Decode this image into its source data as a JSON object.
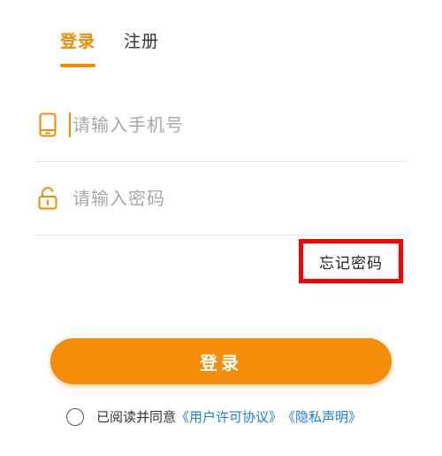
{
  "tabs": {
    "login": "登录",
    "register": "注册"
  },
  "phone": {
    "placeholder": "请输入手机号",
    "icon": "phone-icon"
  },
  "password": {
    "placeholder": "请输入密码",
    "icon": "lock-icon"
  },
  "forgot_password": "忘记密码",
  "login_button": "登录",
  "agreement": {
    "text": "已阅读并同意",
    "user_agreement": "《用户许可协议》",
    "privacy": "《隐私声明》"
  },
  "colors": {
    "accent": "#f08c00",
    "button": "#f58c0a",
    "link": "#1a7fd4",
    "highlight_box": "#ff0000"
  }
}
